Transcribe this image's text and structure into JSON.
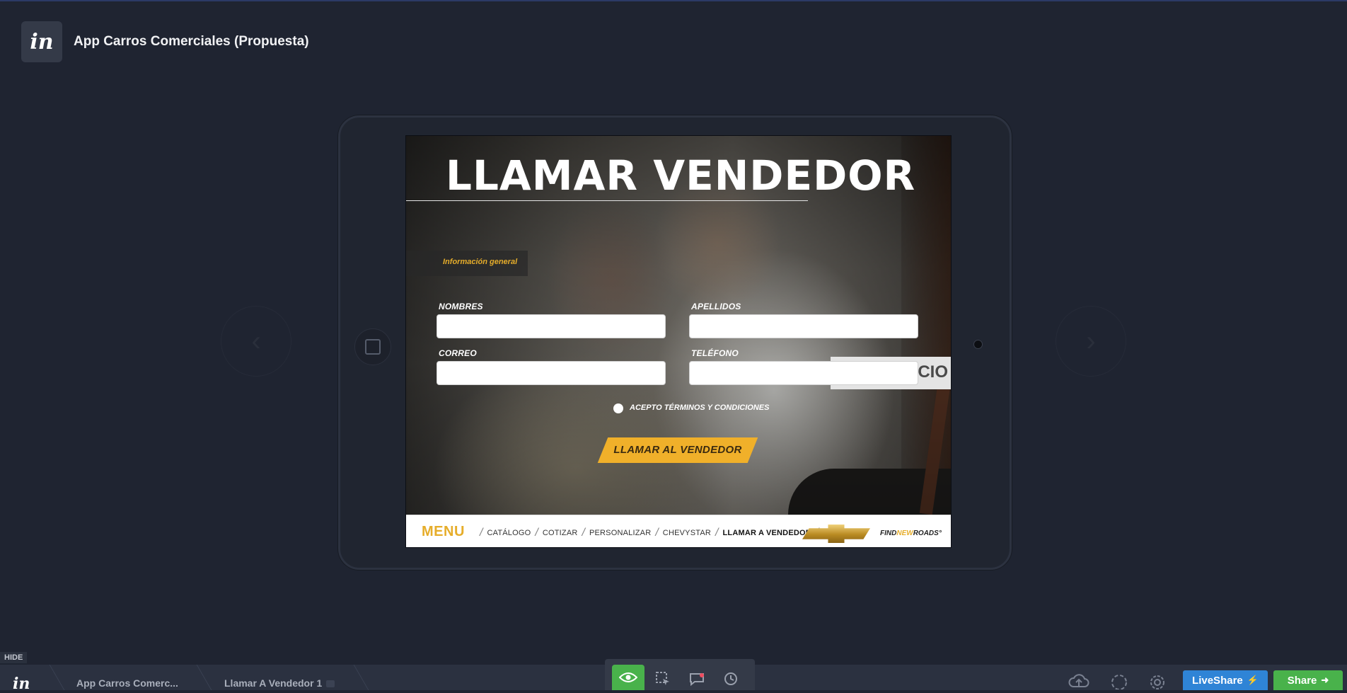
{
  "app": {
    "logo_text": "in",
    "project_title": "App Carros Comerciales (Propuesta)"
  },
  "navigation": {
    "prev_icon": "‹",
    "next_icon": "›"
  },
  "screen": {
    "title": "LLAMAR VENDEDOR",
    "section_label": "Información general",
    "fields": {
      "nombres_label": "NOMBRES",
      "apellidos_label": "APELLIDOS",
      "correo_label": "CORREO",
      "telefono_label": "TELÉFONO"
    },
    "background_sign_text": "CIO",
    "terms_label": "ACEPTO TÉRMINOS Y CONDICIONES",
    "cta_label": "LLAMAR AL VENDEDOR",
    "menu": {
      "menu_word": "MENU",
      "items": [
        "CATÁLOGO",
        "COTIZAR",
        "PERSONALIZAR",
        "CHEVYSTAR",
        "LLAMAR A VENDEDOR"
      ],
      "tagline_pre": "FIND",
      "tagline_accent": "NEW",
      "tagline_post": "ROADS",
      "tagline_mark": "°"
    }
  },
  "bottom_bar": {
    "hide_label": "HIDE",
    "logo_text": "in",
    "breadcrumb_project": "App Carros Comerc...",
    "breadcrumb_screen": "Llamar A Vendedor 1",
    "liveshare_label": "LiveShare",
    "share_label": "Share"
  },
  "colors": {
    "accent_yellow": "#e6ad2a",
    "preview_green": "#49b24b",
    "liveshare_blue": "#2f84d6",
    "background": "#1f2431"
  }
}
